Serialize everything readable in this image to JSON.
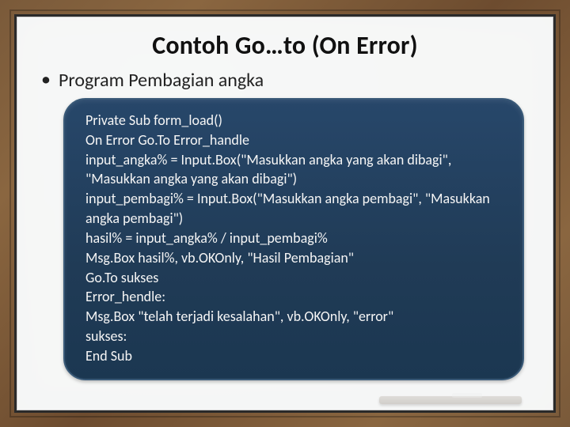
{
  "slide": {
    "title": "Contoh Go…to (On Error)",
    "bullet_char": "•",
    "subtitle": "Program Pembagian angka",
    "code_lines": [
      "Private Sub form_load()",
      "On Error Go.To Error_handle",
      "input_angka% = Input.Box(\"Masukkan angka yang akan dibagi\", \"Masukkan angka yang akan dibagi\")",
      "input_pembagi% = Input.Box(\"Masukkan angka pembagi\", \"Masukkan angka pembagi\")",
      "hasil% = input_angka% / input_pembagi%",
      "Msg.Box hasil%, vb.OKOnly, \"Hasil Pembagian\"",
      "Go.To sukses",
      "Error_hendle:",
      "Msg.Box \"telah terjadi kesalahan\", vb.OKOnly, \"error\"",
      "sukses:",
      "End Sub"
    ]
  }
}
